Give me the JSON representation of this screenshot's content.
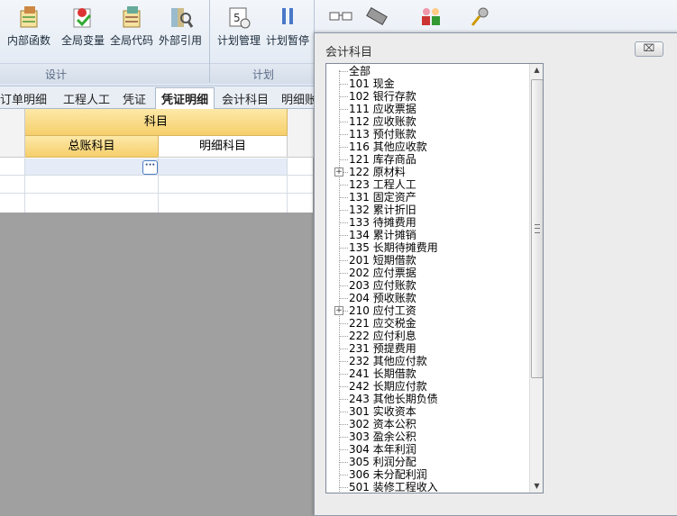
{
  "ribbon": {
    "buttons": [
      {
        "label": "内部函数",
        "icon": "function-icon"
      },
      {
        "label": "全局变量",
        "icon": "global-variable-icon"
      },
      {
        "label": "全局代码",
        "icon": "global-code-icon"
      },
      {
        "label": "外部引用",
        "icon": "external-reference-icon"
      },
      {
        "label": "计划管理",
        "icon": "schedule-icon"
      },
      {
        "label": "计划暂停",
        "icon": "pause-icon"
      }
    ],
    "groups": [
      "设计",
      "计划"
    ]
  },
  "tabs": [
    "订单明细",
    "工程人工",
    "凭证",
    "凭证明细",
    "会计科目",
    "明细账"
  ],
  "active_tab": "凭证明细",
  "grid": {
    "group_header": "科目",
    "col1": "总账科目",
    "col2": "明细科目",
    "ellipsis": "···"
  },
  "dialog": {
    "title": "会计科目",
    "close": "⌧",
    "root": "全部",
    "items": [
      {
        "code": "101",
        "name": "现金"
      },
      {
        "code": "102",
        "name": "银行存款"
      },
      {
        "code": "111",
        "name": "应收票据"
      },
      {
        "code": "112",
        "name": "应收账款"
      },
      {
        "code": "113",
        "name": "预付账款"
      },
      {
        "code": "116",
        "name": "其他应收款"
      },
      {
        "code": "121",
        "name": "库存商品"
      },
      {
        "code": "122",
        "name": "原材料",
        "expander": "+"
      },
      {
        "code": "123",
        "name": "工程人工"
      },
      {
        "code": "131",
        "name": "固定资产"
      },
      {
        "code": "132",
        "name": "累计折旧"
      },
      {
        "code": "133",
        "name": "待摊费用"
      },
      {
        "code": "134",
        "name": "累计摊销"
      },
      {
        "code": "135",
        "name": "长期待摊费用"
      },
      {
        "code": "201",
        "name": "短期借款"
      },
      {
        "code": "202",
        "name": "应付票据"
      },
      {
        "code": "203",
        "name": "应付账款"
      },
      {
        "code": "204",
        "name": "预收账款"
      },
      {
        "code": "210",
        "name": "应付工资",
        "expander": "+"
      },
      {
        "code": "221",
        "name": "应交税金"
      },
      {
        "code": "222",
        "name": "应付利息"
      },
      {
        "code": "231",
        "name": "预提费用"
      },
      {
        "code": "232",
        "name": "其他应付款"
      },
      {
        "code": "241",
        "name": "长期借款"
      },
      {
        "code": "242",
        "name": "长期应付款"
      },
      {
        "code": "243",
        "name": "其他长期负债"
      },
      {
        "code": "301",
        "name": "实收资本"
      },
      {
        "code": "302",
        "name": "资本公积"
      },
      {
        "code": "303",
        "name": "盈余公积"
      },
      {
        "code": "304",
        "name": "本年利润"
      },
      {
        "code": "305",
        "name": "利润分配"
      },
      {
        "code": "306",
        "name": "未分配利润"
      },
      {
        "code": "501",
        "name": "装修工程收入"
      }
    ]
  },
  "colors": {
    "header_gold": "#f6cf6b",
    "ribbon_blue": "#dfe7f2",
    "workspace_gray": "#a0a0a0"
  }
}
